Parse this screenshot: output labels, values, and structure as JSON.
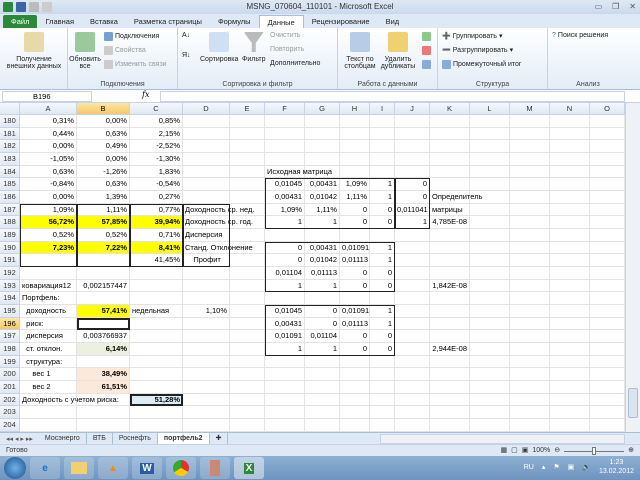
{
  "window": {
    "title": "MSNG_070604_110101 - Microsoft Excel"
  },
  "tabs": [
    {
      "label": "Файл"
    },
    {
      "label": "Главная"
    },
    {
      "label": "Вставка"
    },
    {
      "label": "Разметка страницы"
    },
    {
      "label": "Формулы"
    },
    {
      "label": "Данные",
      "active": true
    },
    {
      "label": "Рецензирование"
    },
    {
      "label": "Вид"
    }
  ],
  "ribbon": {
    "get_external": "Получение внешних данных",
    "refresh_all": "Обновить все",
    "connections": "Подключения",
    "properties": "Свойства",
    "edit_links": "Изменить связи",
    "group_connections": "Подключения",
    "sort": "Сортировка",
    "filter": "Фильтр",
    "clear": "Очистить",
    "reapply": "Повторить",
    "advanced": "Дополнительно",
    "group_sort": "Сортировка и фильтр",
    "text_to_columns": "Текст по столбцам",
    "remove_duplicates": "Удалить дубликаты",
    "group_data_tools": "Работа с данными",
    "group": "Группировать",
    "ungroup": "Разгруппировать",
    "subtotal": "Промежуточный итог",
    "group_outline": "Структура",
    "solver": "Поиск решения",
    "group_analysis": "Анализ"
  },
  "formula_bar": {
    "name_box": "B196",
    "fx": "fx",
    "formula": ""
  },
  "columns": [
    "A",
    "B",
    "C",
    "D",
    "E",
    "F",
    "G",
    "H",
    "I",
    "J",
    "K",
    "L",
    "M",
    "N",
    "O"
  ],
  "selected_cell": {
    "col": "B",
    "row": 196
  },
  "rows": [
    {
      "n": 180,
      "cells": {
        "A": "0,31%",
        "B": "0,00%",
        "C": "0,85%"
      }
    },
    {
      "n": 181,
      "cells": {
        "A": "0,44%",
        "B": "0,63%",
        "C": "2,15%"
      }
    },
    {
      "n": 182,
      "cells": {
        "A": "0,00%",
        "B": "0,49%",
        "C": "-2,52%"
      }
    },
    {
      "n": 183,
      "cells": {
        "A": "-1,05%",
        "B": "0,00%",
        "C": "-1,30%"
      }
    },
    {
      "n": 184,
      "cells": {
        "A": "0,63%",
        "B": "-1,26%",
        "C": "1,83%",
        "F": "Исходная матрица"
      }
    },
    {
      "n": 185,
      "cells": {
        "A": "-0,84%",
        "B": "0,63%",
        "C": "-0,54%",
        "F": "0,01045",
        "G": "0,00431",
        "H": "1,09%",
        "I": "1",
        "J": "0"
      }
    },
    {
      "n": 186,
      "cells": {
        "A": "0,00%",
        "B": "1,39%",
        "C": "0,27%",
        "F": "0,00431",
        "G": "0,01042",
        "H": "1,11%",
        "I": "1",
        "J": "0",
        "K": "Определитель"
      }
    },
    {
      "n": 187,
      "cells": {
        "A": "1,09%",
        "B": "1,11%",
        "C": "0,77%",
        "D": "Доходность ср. нед.",
        "F": "1,09%",
        "G": "1,11%",
        "H": "0",
        "I": "0",
        "J": "0,011041",
        "K": "матрицы"
      }
    },
    {
      "n": 188,
      "cells": {
        "A": "56,72%",
        "B": "57,85%",
        "C": "39,94%",
        "D": "Доходность ср. год.",
        "F": "1",
        "G": "1",
        "H": "0",
        "I": "0",
        "J": "1",
        "K": "4,785E-08"
      }
    },
    {
      "n": 189,
      "cells": {
        "A": "0,52%",
        "B": "0,52%",
        "C": "0,71%",
        "D": "Дисперсия"
      }
    },
    {
      "n": 190,
      "cells": {
        "A": "7,23%",
        "B": "7,22%",
        "C": "8,41%",
        "D": "Станд. Отклонение",
        "F": "0",
        "G": "0,00431",
        "H": "0,01091",
        "I": "1"
      }
    },
    {
      "n": 191,
      "cells": {
        "C": "41,45%",
        "D": "    Профит",
        "F": "0",
        "G": "0,01042",
        "H": "0,01113",
        "I": "1"
      }
    },
    {
      "n": 192,
      "cells": {
        "F": "0,01104",
        "G": "0,01113",
        "H": "0",
        "I": "0"
      }
    },
    {
      "n": 193,
      "cells": {
        "A": "ковариация12",
        "B": "0,002157447",
        "F": "1",
        "G": "1",
        "H": "0",
        "I": "0",
        "K": "1,842E-08"
      }
    },
    {
      "n": 194,
      "cells": {
        "A": "Портфель:"
      }
    },
    {
      "n": 195,
      "cells": {
        "A": "  доходность",
        "B": "57,41%",
        "C": "недельная",
        "D": "1,10%",
        "F": "0,01045",
        "G": "0",
        "H": "0,01091",
        "I": "1"
      }
    },
    {
      "n": 196,
      "cells": {
        "A": "  риск:",
        "F": "0,00431",
        "G": "0",
        "H": "0,01113",
        "I": "1"
      }
    },
    {
      "n": 197,
      "cells": {
        "A": "  дисперсия",
        "B": "0,003766937",
        "F": "0,01091",
        "G": "0,01104",
        "H": "0",
        "I": "0"
      }
    },
    {
      "n": 198,
      "cells": {
        "A": "  ст. отклон.",
        "B": "6,14%",
        "F": "1",
        "G": "1",
        "H": "0",
        "I": "0",
        "K": "2,944E-08"
      }
    },
    {
      "n": 199,
      "cells": {
        "A": "  структура:"
      }
    },
    {
      "n": 200,
      "cells": {
        "A": "     вес 1",
        "B": "38,49%"
      }
    },
    {
      "n": 201,
      "cells": {
        "A": "     вес 2",
        "B": "61,51%"
      }
    },
    {
      "n": 202,
      "cells": {
        "A": "Доходность с учетом риска:",
        "C": "51,28%"
      }
    },
    {
      "n": 203,
      "cells": {}
    },
    {
      "n": 204,
      "cells": {}
    }
  ],
  "sheet_tabs": [
    {
      "label": "Мосэнерго"
    },
    {
      "label": "ВТБ"
    },
    {
      "label": "Роснефть"
    },
    {
      "label": "портфель2",
      "active": true
    }
  ],
  "status": {
    "text": "Готово",
    "zoom": "100%"
  },
  "taskbar": {
    "lang": "RU",
    "time": "1:23",
    "date": "13.02.2012",
    "apps": [
      "ie",
      "explorer",
      "vlc",
      "word",
      "chrome",
      "archive",
      "excel"
    ]
  },
  "colors": {
    "highlight": "#ffff00",
    "excel_green": "#2a8a3a"
  }
}
